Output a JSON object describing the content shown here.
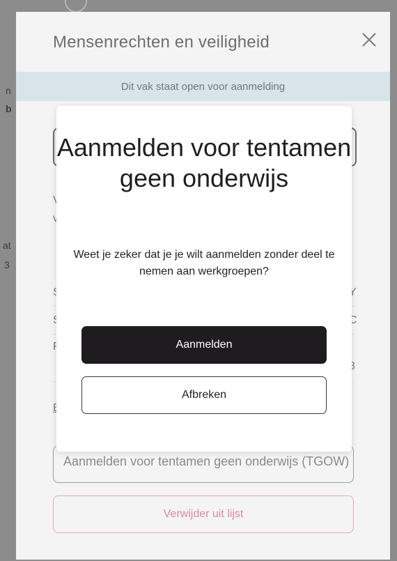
{
  "panel": {
    "title": "Mensenrechten en veiligheid",
    "banner": "Dit vak staat open voor aanmelding",
    "select_value": "Aanmelden voor tentamen geen onderwijs (TGOW)",
    "remove_label": "Verwijder uit lijst"
  },
  "modal": {
    "title": "Aanmelden voor tentamen geen onderwijs",
    "message": "Weet je zeker dat je je wilt aanmelden zonder deel te nemen aan werkgroepen?",
    "confirm_label": "Aanmelden",
    "cancel_label": "Afbreken"
  },
  "colors": {
    "confirm_bg": "#1e1c1f",
    "banner_bg": "#d7e4ea",
    "remove_accent": "#d98a9c"
  },
  "icons": {
    "close": "close-icon"
  }
}
